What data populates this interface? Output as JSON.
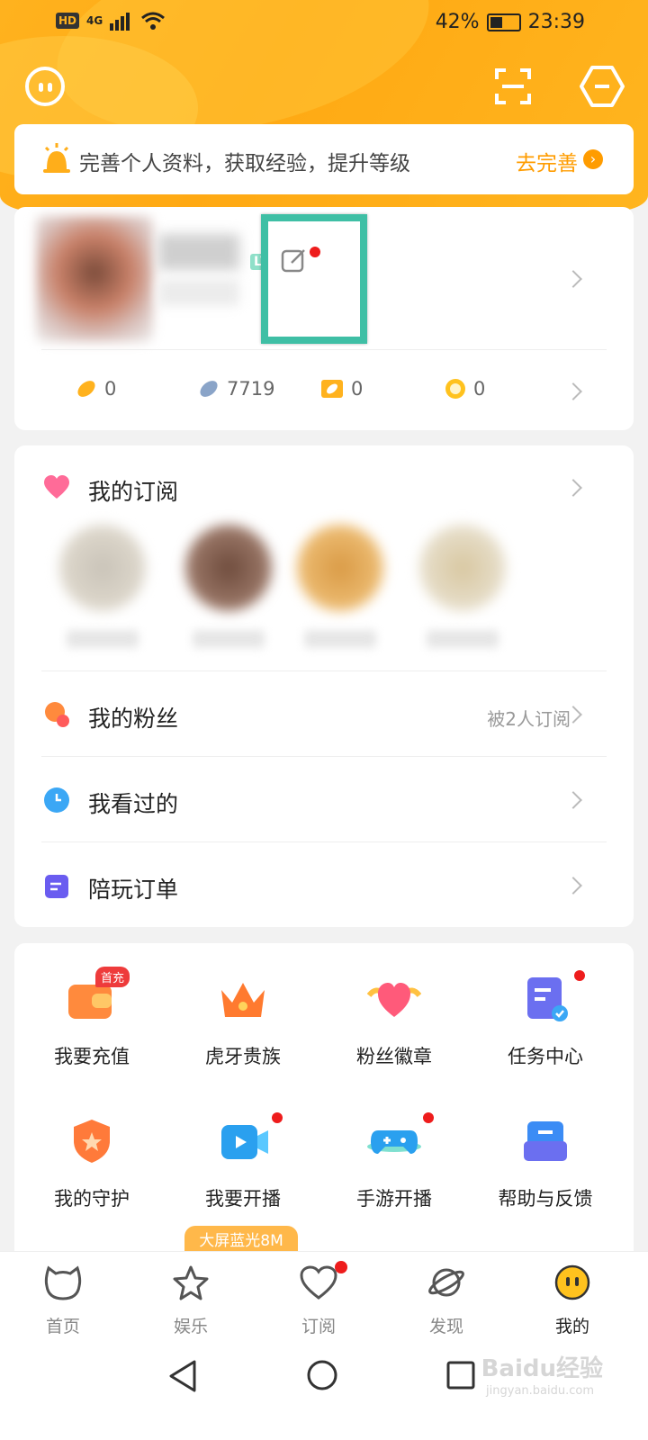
{
  "status_bar": {
    "network": "4G",
    "hd": "HD",
    "battery": "42%",
    "battery_level": 0.42,
    "time": "23:39"
  },
  "banner": {
    "text": "完善个人资料，获取经验，提升等级",
    "action": "去完善"
  },
  "profile": {
    "level_tag": "LV",
    "stats": [
      {
        "icon": "gold-bean-icon",
        "value": "0"
      },
      {
        "icon": "silver-bean-icon",
        "value": "7719"
      },
      {
        "icon": "ticket-icon",
        "value": "0"
      },
      {
        "icon": "coin-icon",
        "value": "0"
      }
    ]
  },
  "subscription": {
    "title": "我的订阅"
  },
  "menu": {
    "fans": {
      "label": "我的粉丝",
      "right": "被2人订阅"
    },
    "history": {
      "label": "我看过的"
    },
    "orders": {
      "label": "陪玩订单"
    }
  },
  "grid": [
    {
      "label": "我要充值",
      "icon": "wallet-icon",
      "tag": "首充"
    },
    {
      "label": "虎牙贵族",
      "icon": "crown-icon"
    },
    {
      "label": "粉丝徽章",
      "icon": "heart-badge-icon"
    },
    {
      "label": "任务中心",
      "icon": "task-icon"
    },
    {
      "label": "我的守护",
      "icon": "shield-icon"
    },
    {
      "label": "我要开播",
      "icon": "video-icon"
    },
    {
      "label": "手游开播",
      "icon": "gamepad-icon"
    },
    {
      "label": "帮助与反馈",
      "icon": "help-icon"
    }
  ],
  "promo": "大屏蓝光8M",
  "tabs": [
    {
      "label": "首页",
      "icon": "home-icon"
    },
    {
      "label": "娱乐",
      "icon": "star-icon"
    },
    {
      "label": "订阅",
      "icon": "heart-icon"
    },
    {
      "label": "发现",
      "icon": "planet-icon"
    },
    {
      "label": "我的",
      "icon": "me-icon"
    }
  ],
  "watermark": {
    "main": "Baidu经验",
    "sub": "jingyan.baidu.com"
  },
  "colors": {
    "accent": "#ffa913",
    "highlight": "#3fbfa5",
    "red_dot": "#ee1c1c"
  }
}
